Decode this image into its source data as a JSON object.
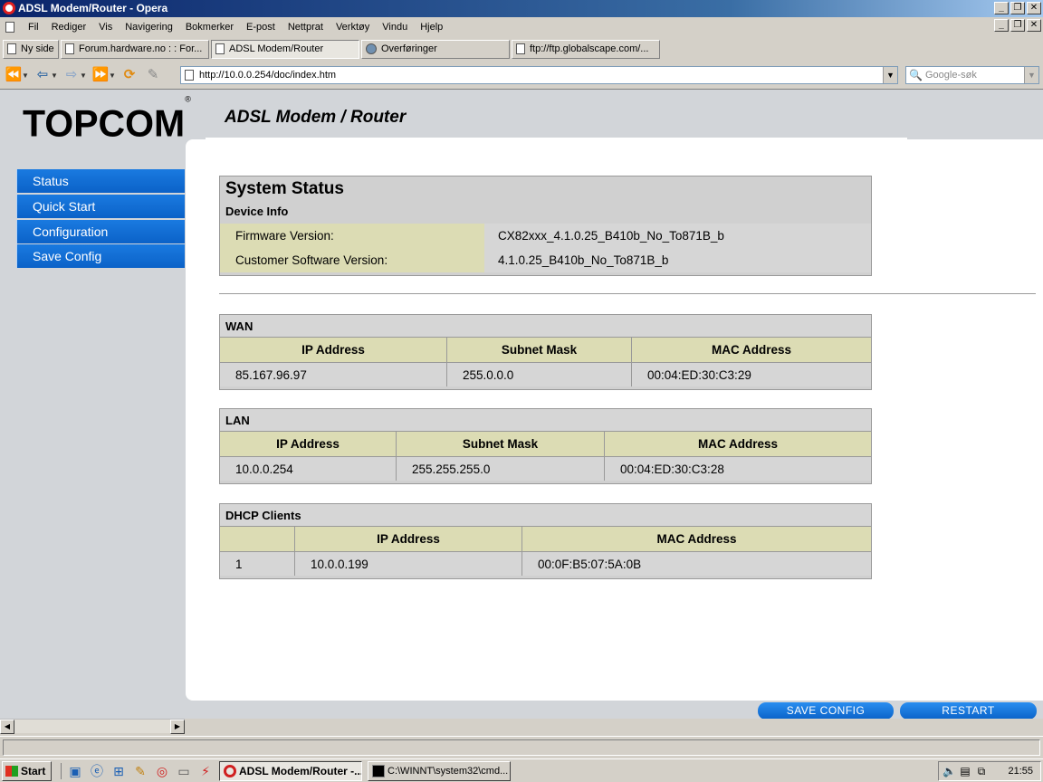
{
  "window": {
    "title": "ADSL Modem/Router - Opera"
  },
  "menu": [
    "Fil",
    "Rediger",
    "Vis",
    "Navigering",
    "Bokmerker",
    "E-post",
    "Nettprat",
    "Verktøy",
    "Vindu",
    "Hjelp"
  ],
  "tabs": [
    {
      "label": "Ny side"
    },
    {
      "label": "Forum.hardware.no : : For..."
    },
    {
      "label": "ADSL Modem/Router"
    },
    {
      "label": "Overføringer"
    },
    {
      "label": "ftp://ftp.globalscape.com/..."
    }
  ],
  "navbar": {
    "url": "http://10.0.0.254/doc/index.htm",
    "search_placeholder": "Google-søk"
  },
  "page": {
    "logo": "TOPCOM",
    "logo_mark": "®",
    "heading": "ADSL Modem / Router",
    "nav": [
      "Status",
      "Quick Start",
      "Configuration",
      "Save Config"
    ],
    "system_status": {
      "title": "System Status",
      "subtitle": "Device Info",
      "rows": [
        {
          "key": "Firmware Version:",
          "value": "CX82xxx_4.1.0.25_B410b_No_To871B_b"
        },
        {
          "key": "Customer Software Version:",
          "value": "4.1.0.25_B410b_No_To871B_b"
        }
      ]
    },
    "wan": {
      "title": "WAN",
      "headers": [
        "IP Address",
        "Subnet Mask",
        "MAC Address"
      ],
      "row": [
        "85.167.96.97",
        "255.0.0.0",
        "00:04:ED:30:C3:29"
      ]
    },
    "lan": {
      "title": "LAN",
      "headers": [
        "IP Address",
        "Subnet Mask",
        "MAC Address"
      ],
      "row": [
        "10.0.0.254",
        "255.255.255.0",
        "00:04:ED:30:C3:28"
      ]
    },
    "dhcp": {
      "title": "DHCP Clients",
      "headers": [
        "",
        "IP Address",
        "MAC Address"
      ],
      "row": [
        "1",
        "10.0.0.199",
        "00:0F:B5:07:5A:0B"
      ]
    },
    "buttons": {
      "save_config": "SAVE CONFIG",
      "restart": "RESTART"
    }
  },
  "taskbar": {
    "start": "Start",
    "tasks": [
      "ADSL Modem/Router -...",
      "C:\\WINNT\\system32\\cmd..."
    ],
    "clock": "21:55"
  }
}
